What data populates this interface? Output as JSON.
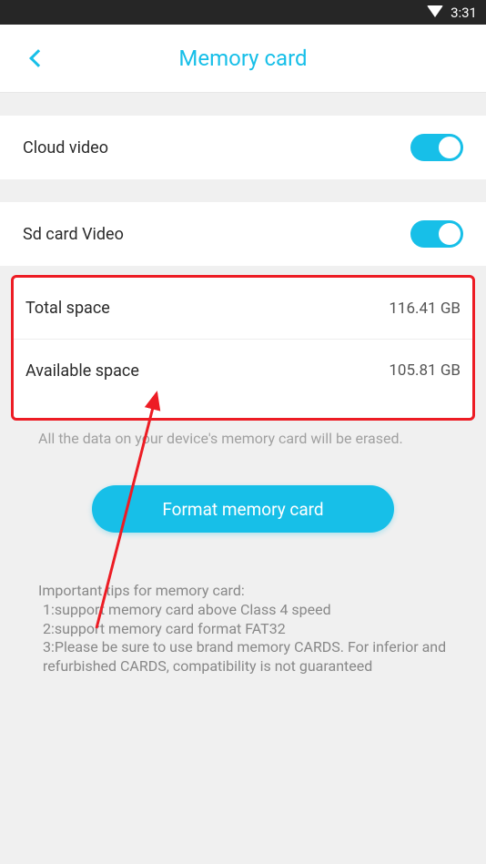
{
  "status_bar": {
    "time": "3:31"
  },
  "header": {
    "title": "Memory card"
  },
  "settings": {
    "cloud_video_label": "Cloud video",
    "sd_card_video_label": "Sd card Video"
  },
  "storage": {
    "total_label": "Total space",
    "total_value": "116.41 GB",
    "available_label": "Available space",
    "available_value": "105.81 GB"
  },
  "warning": "All the data on your device's memory card will be erased.",
  "format_button_label": "Format memory card",
  "tips": {
    "title": "Important tips for memory card:",
    "item1": " 1:support memory card above Class 4 speed",
    "item2": " 2:support memory card format FAT32",
    "item3": " 3:Please be sure to use brand memory CARDS. For inferior and refurbished CARDS, compatibility is not guaranteed"
  }
}
